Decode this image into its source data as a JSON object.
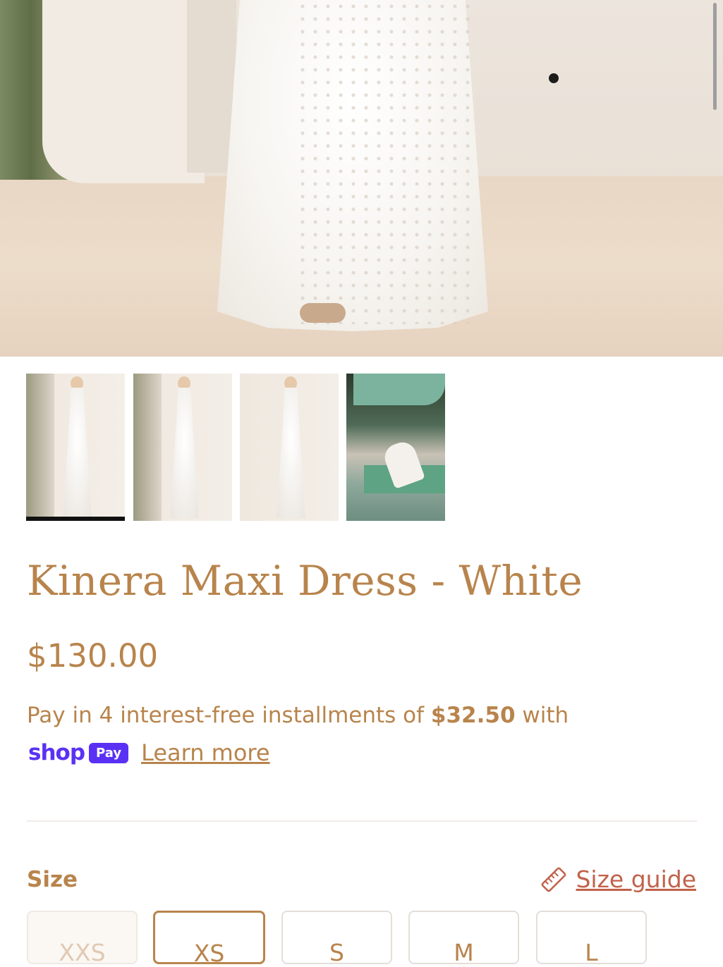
{
  "product": {
    "title": "Kinera Maxi Dress - White",
    "price": "$130.00"
  },
  "installments": {
    "prefix": "Pay in 4 interest-free installments of",
    "amount": "$32.50",
    "suffix": "with",
    "shop_logo": "shop",
    "pay_badge": "Pay",
    "learn_more": "Learn more"
  },
  "size": {
    "label": "Size",
    "guide_label": "Size guide",
    "options": [
      {
        "label": "XXS",
        "state": "unavailable"
      },
      {
        "label": "XS",
        "state": "selected"
      },
      {
        "label": "S",
        "state": "available"
      },
      {
        "label": "M",
        "state": "available"
      },
      {
        "label": "L",
        "state": "available"
      }
    ]
  },
  "gallery": {
    "active_index": 0,
    "thumb_count": 4
  },
  "icons": {
    "size_guide": "ruler-icon"
  },
  "colors": {
    "accent": "#b8844c",
    "link": "#c1624a",
    "shop_pay": "#5a31f4"
  }
}
